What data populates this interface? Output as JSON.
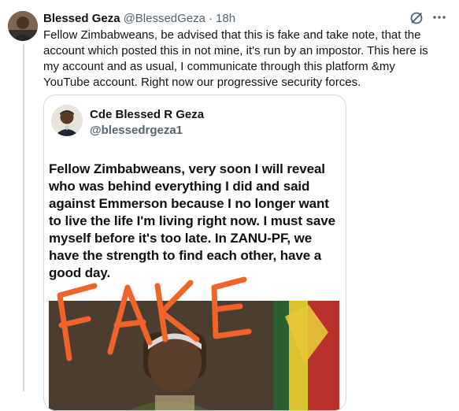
{
  "tweet": {
    "author_name": "Blessed Geza",
    "author_handle": "@BlessedGeza",
    "separator": "·",
    "time": "18h",
    "text": "Fellow Zimbabweans,  be advised that this is fake and take note, that the account which posted this in not mine, it's run by an impostor. This here is my account and as usual, I communicate through this platform &my YouTube account. Right now our progressive security forces."
  },
  "quoted_post": {
    "author_name": "Cde Blessed R Geza",
    "author_handle": "@blessedrgeza1",
    "text": "Fellow Zimbabweans, very soon I will reveal who was behind everything I did and said against Emmerson because I no longer want to live the life I'm living right now. I must save myself before it's too late. In ZANU-PF, we have the strength to find each other, have a good day.",
    "overlay_word": "FAKE"
  },
  "icons": {
    "grok": "grok-icon",
    "more": "more-options-icon"
  },
  "colors": {
    "text_primary": "#0f1419",
    "text_secondary": "#536471",
    "border": "#cfd9de",
    "overlay_scribble": "#f0642a"
  }
}
